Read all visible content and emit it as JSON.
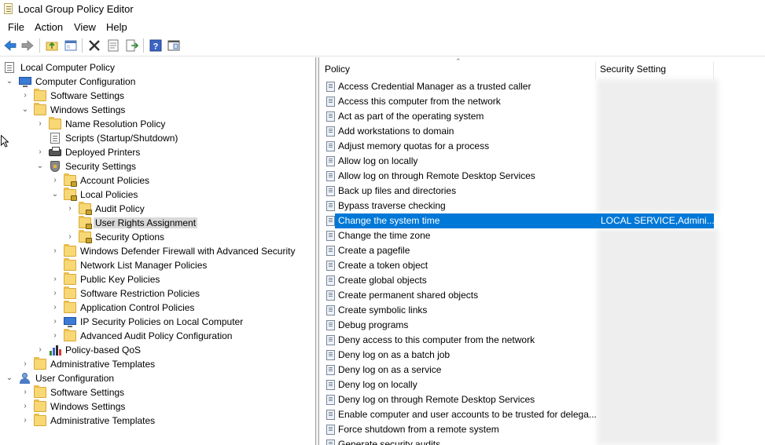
{
  "window": {
    "title": "Local Group Policy Editor"
  },
  "menubar": {
    "items": [
      "File",
      "Action",
      "View",
      "Help"
    ]
  },
  "toolbar": {
    "buttons": [
      "back-icon",
      "forward-icon",
      "up-folder-icon",
      "show-hide-tree-icon",
      "delete-icon",
      "properties-icon",
      "export-list-icon",
      "help-icon",
      "extended-view-icon"
    ]
  },
  "tree": {
    "items": [
      {
        "label": "Local Computer Policy"
      },
      {
        "label": "Computer Configuration"
      },
      {
        "label": "Software Settings"
      },
      {
        "label": "Windows Settings"
      },
      {
        "label": "Name Resolution Policy"
      },
      {
        "label": "Scripts (Startup/Shutdown)"
      },
      {
        "label": "Deployed Printers"
      },
      {
        "label": "Security Settings"
      },
      {
        "label": "Account Policies"
      },
      {
        "label": "Local Policies"
      },
      {
        "label": "Audit Policy"
      },
      {
        "label": "User Rights Assignment"
      },
      {
        "label": "Security Options"
      },
      {
        "label": "Windows Defender Firewall with Advanced Security"
      },
      {
        "label": "Network List Manager Policies"
      },
      {
        "label": "Public Key Policies"
      },
      {
        "label": "Software Restriction Policies"
      },
      {
        "label": "Application Control Policies"
      },
      {
        "label": "IP Security Policies on Local Computer"
      },
      {
        "label": "Advanced Audit Policy Configuration"
      },
      {
        "label": "Policy-based QoS"
      },
      {
        "label": "Administrative Templates"
      },
      {
        "label": "User Configuration"
      },
      {
        "label": "Software Settings"
      },
      {
        "label": "Windows Settings"
      },
      {
        "label": "Administrative Templates"
      }
    ]
  },
  "list": {
    "columns": {
      "policy": "Policy",
      "setting": "Security Setting"
    },
    "rows": [
      {
        "policy": "Access Credential Manager as a trusted caller",
        "setting": ""
      },
      {
        "policy": "Access this computer from the network",
        "setting": ""
      },
      {
        "policy": "Act as part of the operating system",
        "setting": ""
      },
      {
        "policy": "Add workstations to domain",
        "setting": ""
      },
      {
        "policy": "Adjust memory quotas for a process",
        "setting": ""
      },
      {
        "policy": "Allow log on locally",
        "setting": ""
      },
      {
        "policy": "Allow log on through Remote Desktop Services",
        "setting": ""
      },
      {
        "policy": "Back up files and directories",
        "setting": ""
      },
      {
        "policy": "Bypass traverse checking",
        "setting": ""
      },
      {
        "policy": "Change the system time",
        "setting": "LOCAL SERVICE,Admini..."
      },
      {
        "policy": "Change the time zone",
        "setting": ""
      },
      {
        "policy": "Create a pagefile",
        "setting": ""
      },
      {
        "policy": "Create a token object",
        "setting": ""
      },
      {
        "policy": "Create global objects",
        "setting": ""
      },
      {
        "policy": "Create permanent shared objects",
        "setting": ""
      },
      {
        "policy": "Create symbolic links",
        "setting": ""
      },
      {
        "policy": "Debug programs",
        "setting": ""
      },
      {
        "policy": "Deny access to this computer from the network",
        "setting": ""
      },
      {
        "policy": "Deny log on as a batch job",
        "setting": ""
      },
      {
        "policy": "Deny log on as a service",
        "setting": ""
      },
      {
        "policy": "Deny log on locally",
        "setting": ""
      },
      {
        "policy": "Deny log on through Remote Desktop Services",
        "setting": ""
      },
      {
        "policy": "Enable computer and user accounts to be trusted for delega...",
        "setting": ""
      },
      {
        "policy": "Force shutdown from a remote system",
        "setting": ""
      },
      {
        "policy": "Generate security audits",
        "setting": ""
      }
    ]
  },
  "colors": {
    "selection": "#0078d7",
    "tree_selection": "#d9d9d9"
  }
}
